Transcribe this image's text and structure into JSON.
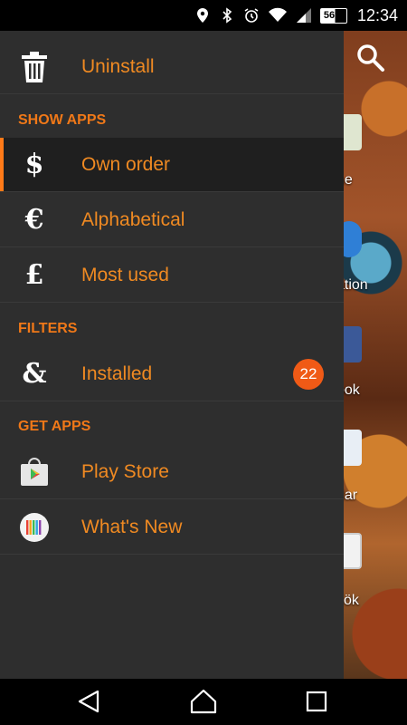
{
  "status_bar": {
    "battery": "56%",
    "time": "12:34"
  },
  "drawer": {
    "top_item": {
      "label": "Uninstall",
      "icon": "trash-icon"
    },
    "sections": [
      {
        "title": "SHOW APPS",
        "items": [
          {
            "label": "Own order",
            "icon": "dollar-icon",
            "selected": true
          },
          {
            "label": "Alphabetical",
            "icon": "euro-icon"
          },
          {
            "label": "Most used",
            "icon": "pound-icon"
          }
        ]
      },
      {
        "title": "FILTERS",
        "items": [
          {
            "label": "Installed",
            "icon": "ampersand-icon",
            "badge": "22"
          }
        ]
      },
      {
        "title": "GET APPS",
        "items": [
          {
            "label": "Play Store",
            "icon": "play-store-icon"
          },
          {
            "label": "What's New",
            "icon": "whats-new-icon"
          }
        ]
      }
    ]
  },
  "background_apps": {
    "labels": [
      "ne",
      "ation",
      "ook",
      "dar",
      "zök"
    ]
  },
  "colors": {
    "drawer_bg": "#2e2e2e",
    "accent": "#f08a22",
    "section": "#f07818",
    "badge": "#f05a16"
  }
}
